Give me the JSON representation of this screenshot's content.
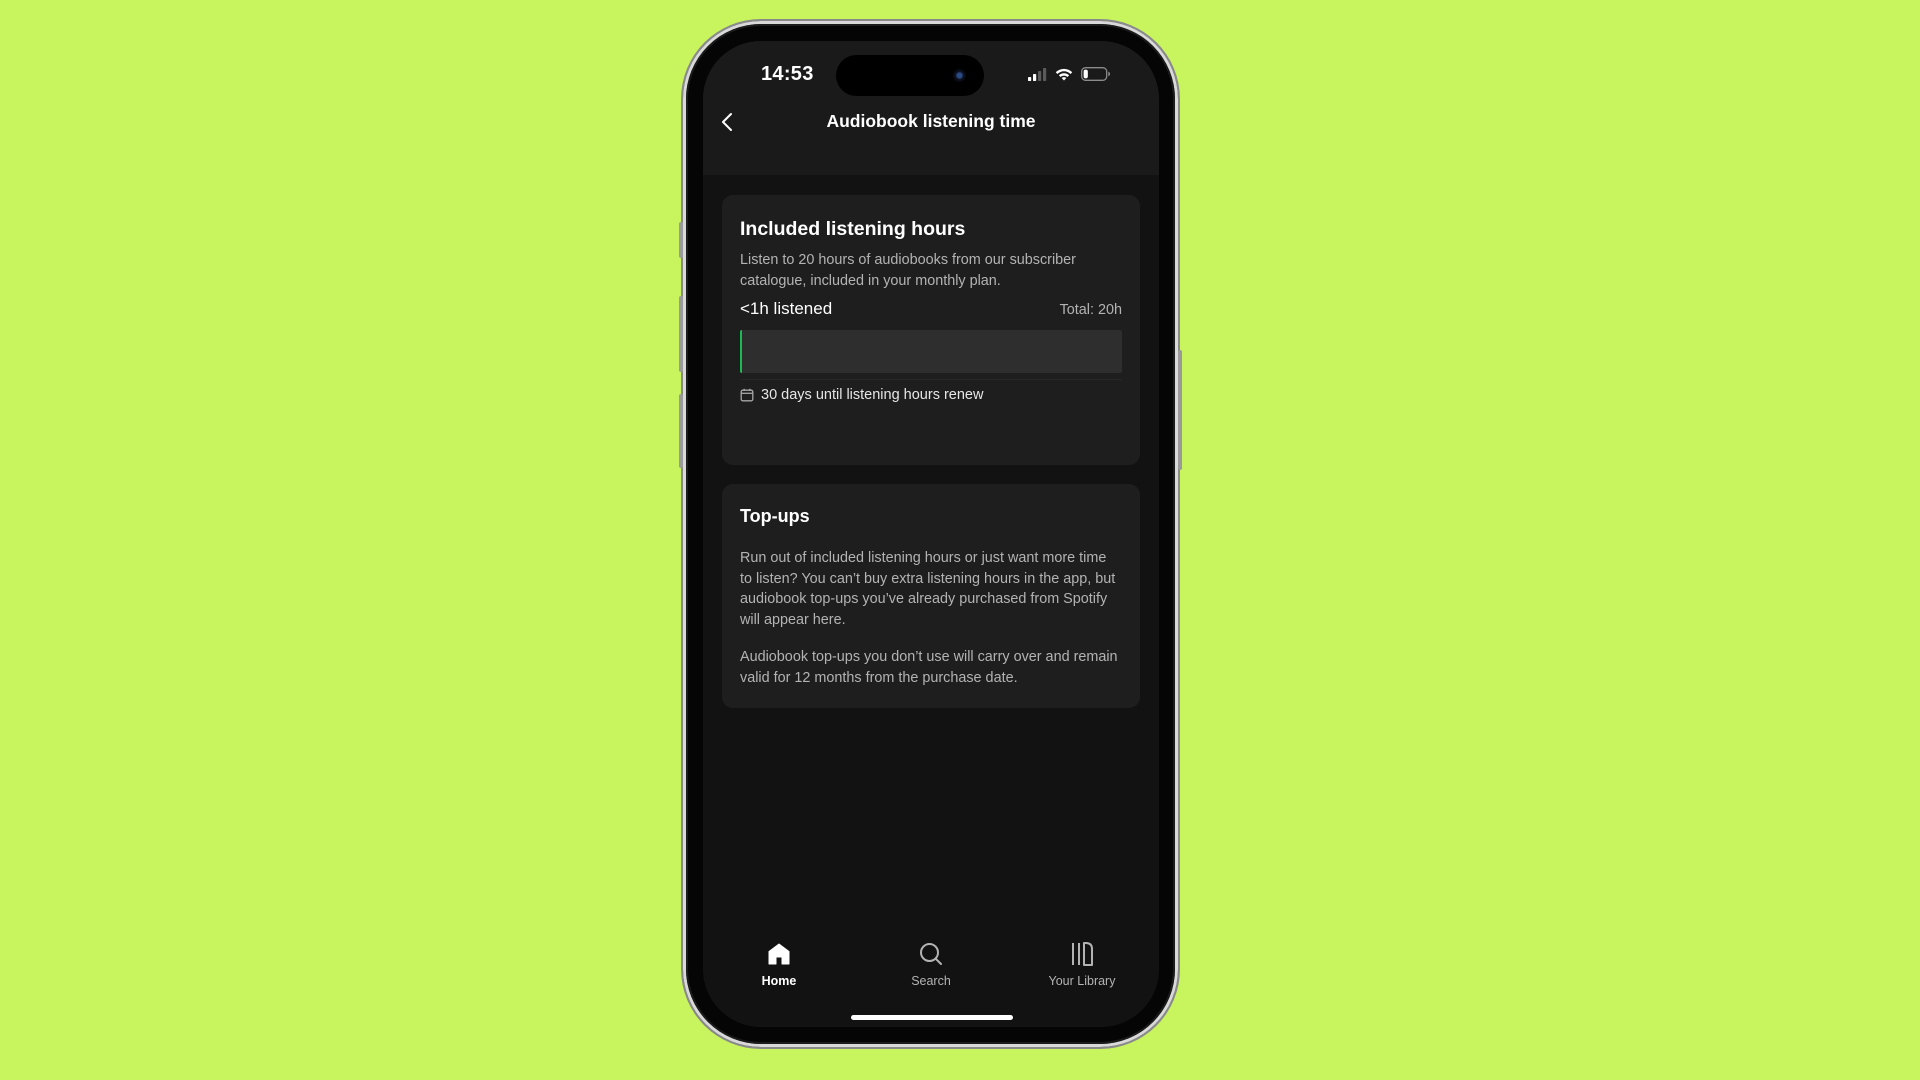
{
  "status_bar": {
    "time": "14:53",
    "signal_bars_active": 2,
    "signal_bars_total": 4,
    "battery_level": 0.2
  },
  "header": {
    "back_icon": "chevron-left-icon",
    "title": "Audiobook listening time"
  },
  "included_hours": {
    "title": "Included listening hours",
    "description": "Listen to 20 hours of audiobooks from our subscriber catalogue, included in your monthly plan.",
    "listened_label": "<1h listened",
    "total_label": "Total: 20h",
    "progress_fraction": 0.005,
    "progress_color": "#1db954",
    "renew_icon": "calendar-icon",
    "renew_text": "30 days until listening hours renew"
  },
  "topups": {
    "title": "Top-ups",
    "paragraph_1": "Run out of included listening hours or just want more time to listen? You can’t buy extra listening hours in the app, but audiobook top-ups you’ve already purchased from Spotify will appear here.",
    "paragraph_2": "Audiobook top-ups you don’t use will carry over and remain valid for 12 months from the purchase date."
  },
  "nav": {
    "items": [
      {
        "label": "Home",
        "icon": "home-icon",
        "active": true
      },
      {
        "label": "Search",
        "icon": "search-icon",
        "active": false
      },
      {
        "label": "Your Library",
        "icon": "library-icon",
        "active": false
      }
    ]
  },
  "colors": {
    "background": "#c8f55e",
    "accent": "#1db954",
    "surface": "#1e1e1e",
    "screen": "#121212"
  }
}
